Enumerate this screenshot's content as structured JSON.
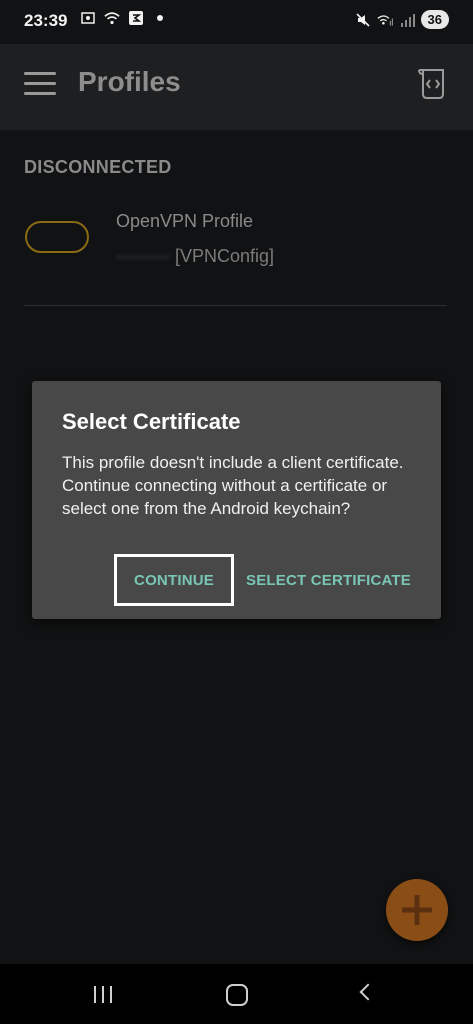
{
  "status_bar": {
    "time": "23:39",
    "battery": "36",
    "left_icons": [
      "screenshot-icon",
      "wifi-icon",
      "app-notification-icon",
      "dot-icon"
    ],
    "right_icons": [
      "mute-icon",
      "wifi-signal-icon",
      "cell-signal-icon"
    ]
  },
  "app_bar": {
    "title": "Profiles",
    "menu_icon": "hamburger-menu-icon",
    "action_icon": "import-config-icon"
  },
  "profiles": {
    "section_title": "DISCONNECTED",
    "items": [
      {
        "name": "OpenVPN Profile",
        "subtitle_redacted": "·········",
        "subtitle_suffix": "[VPNConfig]"
      }
    ]
  },
  "dialog": {
    "title": "Select Certificate",
    "body": "This profile doesn't include a client certificate. Continue connecting without a certificate or select one from the Android keychain?",
    "continue_label": "CONTINUE",
    "select_label": "SELECT CERTIFICATE"
  },
  "fab": {
    "icon": "plus-icon"
  },
  "colors": {
    "accent": "#7ac6b6",
    "toggle_border": "#8a6a14",
    "fab": "#8a4d16",
    "dialog_bg": "#484848"
  }
}
